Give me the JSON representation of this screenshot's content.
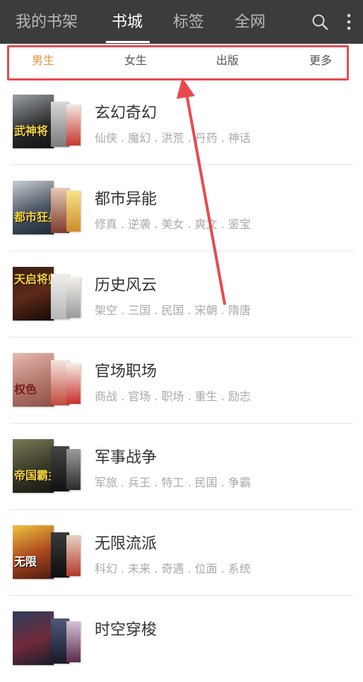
{
  "header": {
    "tabs": [
      {
        "label": "我的书架",
        "active": false
      },
      {
        "label": "书城",
        "active": true
      },
      {
        "label": "标签",
        "active": false
      },
      {
        "label": "全网",
        "active": false
      }
    ],
    "search_icon": "search-icon",
    "more_icon": "more-vertical-icon"
  },
  "subtabs": [
    {
      "label": "男生",
      "active": true
    },
    {
      "label": "女生",
      "active": false
    },
    {
      "label": "出版",
      "active": false
    },
    {
      "label": "更多",
      "active": false
    }
  ],
  "colors": {
    "topbar": "#3c3c3c",
    "active_subtab": "#e8923a",
    "annotation_red": "#e84a4f"
  },
  "categories": [
    {
      "title": "玄幻奇幻",
      "tags": "仙侠 . 魔幻 . 洪荒 . 丹药 . 神话",
      "cover_text": "武神将"
    },
    {
      "title": "都市异能",
      "tags": "修真 . 逆袭 . 美女 . 爽文 . 鉴宝",
      "cover_text": "都市狂兵"
    },
    {
      "title": "历史风云",
      "tags": "架空 . 三国 . 民国 . 宋朝 . 隋唐",
      "cover_text": "天启将帅"
    },
    {
      "title": "官场职场",
      "tags": "商战 . 官场 . 职场 . 重生 . 励志",
      "cover_text": "权色"
    },
    {
      "title": "军事战争",
      "tags": "军旅 . 兵王 . 特工 . 民国 . 争霸",
      "cover_text": "帝国霸主"
    },
    {
      "title": "无限流派",
      "tags": "科幻 . 未来 . 奇遇 . 位面 . 系统",
      "cover_text": "无限"
    },
    {
      "title": "时空穿梭",
      "tags": "",
      "cover_text": ""
    }
  ]
}
